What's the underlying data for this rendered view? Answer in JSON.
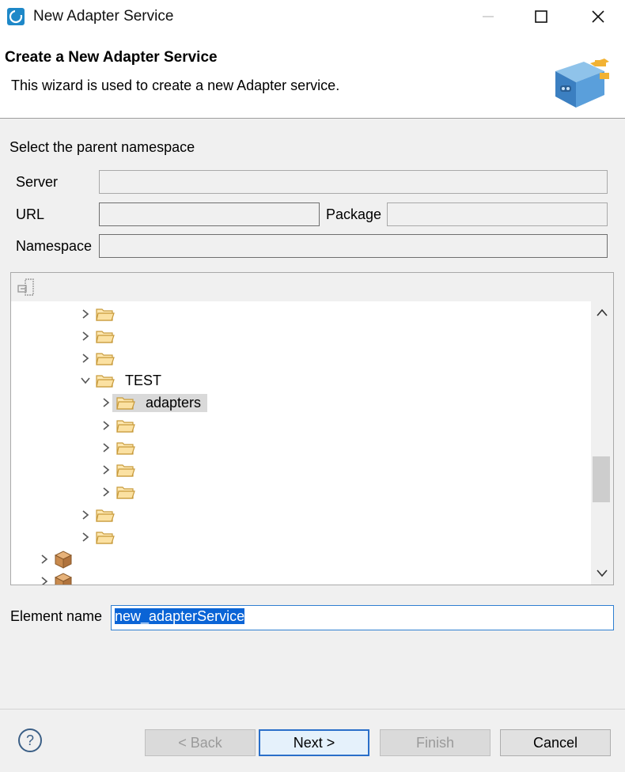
{
  "window": {
    "title": "New Adapter Service"
  },
  "header": {
    "title": "Create a New Adapter Service",
    "description": "This wizard is used to create a new Adapter service."
  },
  "namespace": {
    "section_label": "Select the parent namespace",
    "server_label": "Server",
    "url_label": "URL",
    "package_label": "Package",
    "namespace_label": "Namespace",
    "server_value": "",
    "url_value": "",
    "package_value": "",
    "namespace_value": ""
  },
  "tree": {
    "nodes": [
      {
        "label": "",
        "expanded": false
      },
      {
        "label": "",
        "expanded": false
      },
      {
        "label": "",
        "expanded": false
      },
      {
        "label": "TEST",
        "expanded": true
      },
      {
        "label": "adapters",
        "expanded": false,
        "selected": true
      },
      {
        "label": "",
        "expanded": false
      },
      {
        "label": "",
        "expanded": false
      },
      {
        "label": "",
        "expanded": false
      },
      {
        "label": "",
        "expanded": false
      },
      {
        "label": "",
        "expanded": false
      },
      {
        "label": "",
        "expanded": false
      },
      {
        "label": "",
        "expanded": false,
        "type": "package"
      },
      {
        "label": "",
        "expanded": false,
        "type": "package"
      }
    ]
  },
  "element": {
    "label": "Element name",
    "value": "new_adapterService"
  },
  "buttons": {
    "back": "< Back",
    "next": "Next >",
    "finish": "Finish",
    "cancel": "Cancel"
  },
  "icons": {
    "app": "app-icon",
    "help": "help-icon",
    "banner": "adapter-plug-icon"
  },
  "colors": {
    "accent": "#2a6fc9",
    "selection": "#0a64d6"
  }
}
